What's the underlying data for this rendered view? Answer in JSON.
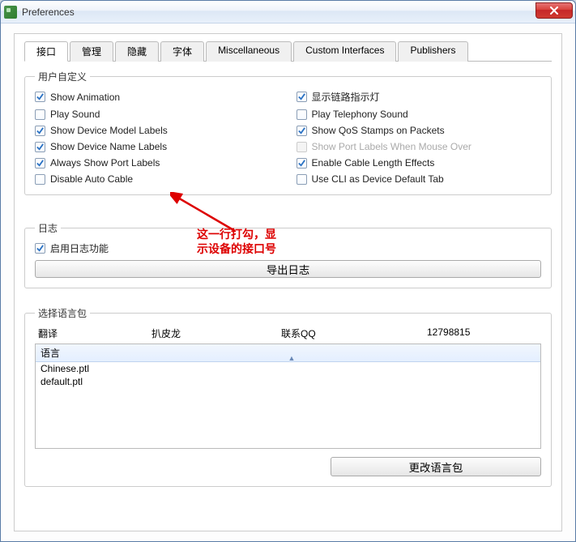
{
  "window": {
    "title": "Preferences"
  },
  "tabs": {
    "t0": "接口",
    "t1": "管理",
    "t2": "隐藏",
    "t3": "字体",
    "t4": "Miscellaneous",
    "t5": "Custom Interfaces",
    "t6": "Publishers"
  },
  "user_custom": {
    "legend": "用户自定义",
    "c0": "Show Animation",
    "c1": "显示链路指示灯",
    "c2": "Play Sound",
    "c3": "Play Telephony Sound",
    "c4": "Show Device Model Labels",
    "c5": "Show QoS Stamps on Packets",
    "c6": "Show Device Name Labels",
    "c7": "Show Port Labels When Mouse Over",
    "c8": "Always Show Port Labels",
    "c9": "Enable Cable Length Effects",
    "c10": "Disable Auto Cable",
    "c11": "Use CLI as Device Default Tab"
  },
  "annotation": {
    "line1": "这一行打勾，显",
    "line2": "示设备的接口号"
  },
  "log": {
    "legend": "日志",
    "enable": "启用日志功能",
    "export_btn": "导出日志"
  },
  "lang": {
    "legend": "选择语言包",
    "col0": "翻译",
    "col1": "扒皮龙",
    "col2": "联系QQ",
    "col3": "12798815",
    "header": "语言",
    "row0": "Chinese.ptl",
    "row1": "default.ptl",
    "change_btn": "更改语言包"
  }
}
